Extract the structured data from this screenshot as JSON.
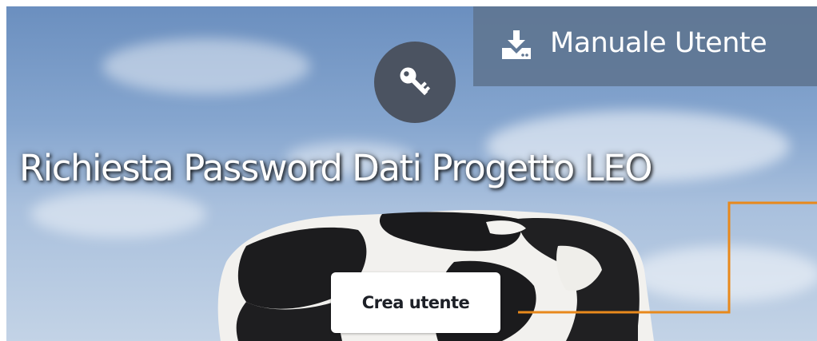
{
  "header": {
    "manual_label": "Manuale Utente",
    "manual_icon": "download-icon"
  },
  "hero": {
    "key_icon": "key-icon",
    "title": "Richiesta Password Dati Progetto LEO"
  },
  "actions": {
    "create_user_label": "Crea utente"
  },
  "colors": {
    "key_circle": "#4b5361",
    "manual_box": "#607692",
    "accent_line": "#e8891c",
    "button_bg": "#ffffff",
    "button_text": "#1d2027"
  }
}
